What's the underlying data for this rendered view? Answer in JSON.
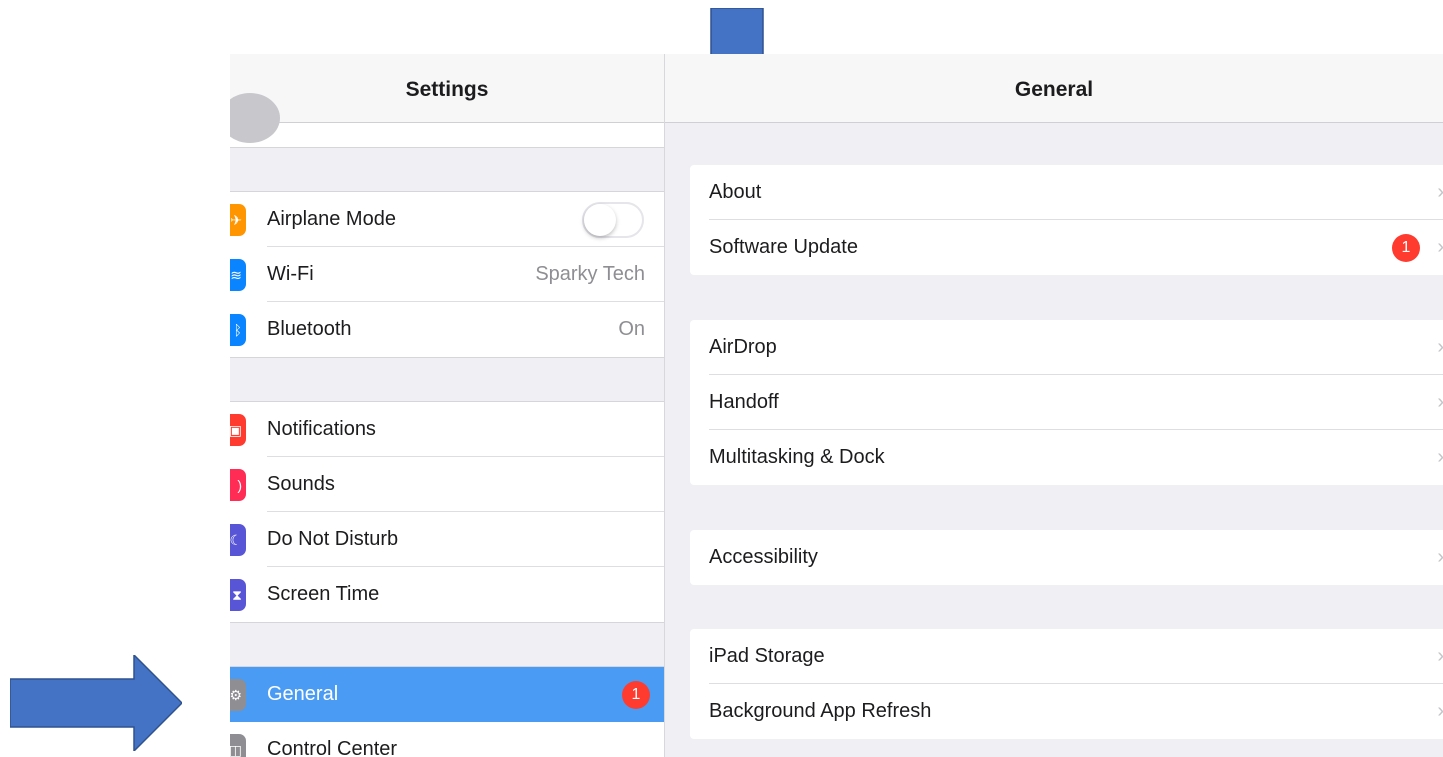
{
  "sidebar": {
    "title": "Settings",
    "groups": [
      [
        {
          "label": "Airplane Mode",
          "icon": "airplane-icon",
          "color": "#ff9500",
          "toggle": "off"
        },
        {
          "label": "Wi-Fi",
          "value": "Sparky Tech",
          "icon": "wifi-icon",
          "color": "#0a84ff"
        },
        {
          "label": "Bluetooth",
          "value": "On",
          "icon": "bluetooth-icon",
          "color": "#0a84ff"
        }
      ],
      [
        {
          "label": "Notifications",
          "icon": "notifications-icon",
          "color": "#ff3b30"
        },
        {
          "label": "Sounds",
          "icon": "sounds-icon",
          "color": "#ff2d55"
        },
        {
          "label": "Do Not Disturb",
          "icon": "moon-icon",
          "color": "#5856d6"
        },
        {
          "label": "Screen Time",
          "icon": "hourglass-icon",
          "color": "#5856d6"
        }
      ],
      [
        {
          "label": "General",
          "badge": "1",
          "icon": "gear-icon",
          "color": "#8e8e93",
          "selected": true
        },
        {
          "label": "Control Center",
          "icon": "control-center-icon",
          "color": "#8e8e93"
        }
      ]
    ]
  },
  "detail": {
    "title": "General",
    "groups": [
      [
        {
          "label": "About"
        },
        {
          "label": "Software Update",
          "badge": "1"
        }
      ],
      [
        {
          "label": "AirDrop"
        },
        {
          "label": "Handoff"
        },
        {
          "label": "Multitasking & Dock"
        }
      ],
      [
        {
          "label": "Accessibility"
        }
      ],
      [
        {
          "label": "iPad Storage"
        },
        {
          "label": "Background App Refresh"
        }
      ]
    ]
  },
  "colors": {
    "arrow": "#4472c4",
    "selection": "#4a9bf4",
    "badge": "#ff3b30"
  }
}
